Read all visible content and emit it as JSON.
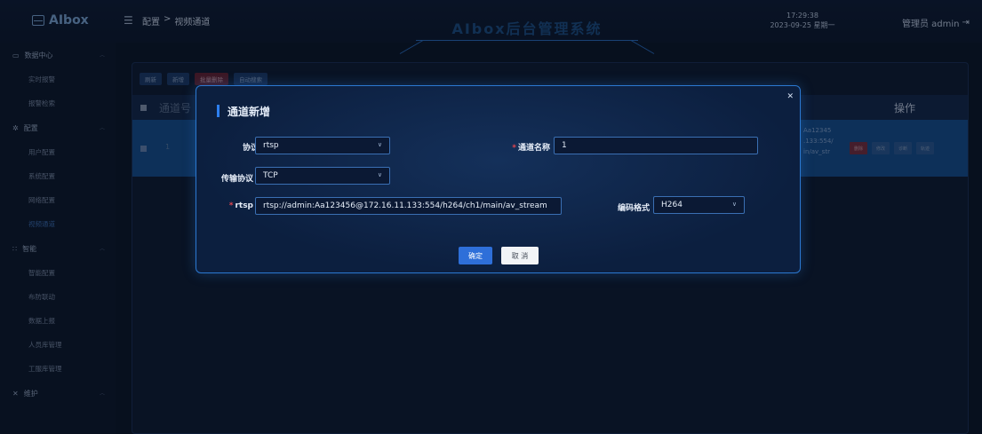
{
  "header": {
    "logo": "AIbox",
    "breadcrumb": [
      "配置",
      ">",
      "视频通道"
    ],
    "title": "AIbox后台管理系统",
    "time": "17:29:38",
    "date": "2023-09-25 星期一",
    "user": "管理员 admin"
  },
  "sidebar": {
    "groups": [
      {
        "label": "数据中心",
        "items": [
          "实时报警",
          "报警检索"
        ]
      },
      {
        "label": "配置",
        "items": [
          "用户配置",
          "系统配置",
          "网络配置",
          "视频通道"
        ]
      },
      {
        "label": "智能",
        "items": [
          "智能配置",
          "布防联动",
          "数据上报",
          "人员库管理",
          "工服库管理"
        ]
      },
      {
        "label": "维护",
        "items": []
      }
    ]
  },
  "toolbar": {
    "refresh": "刷新",
    "add": "新增",
    "batch_delete": "批量删除",
    "auto_search": "自动搜索"
  },
  "table": {
    "col_channel": "通道号",
    "col_ops": "操作",
    "row": {
      "num": "1",
      "rtsp_fragment": "Aa12345\n.133:554/\nin/av_str",
      "ops": [
        "删除",
        "修改",
        "诊断",
        "轨迹"
      ]
    }
  },
  "modal": {
    "title": "通道新增",
    "protocol_label": "协议",
    "protocol_value": "rtsp",
    "channel_name_label": "通道名称",
    "channel_name_value": "1",
    "transport_label": "传输协议",
    "transport_value": "TCP",
    "rtsp_label": "rtsp",
    "rtsp_value": "rtsp://admin:Aa123456@172.16.11.133:554/h264/ch1/main/av_stream",
    "codec_label": "编码格式",
    "codec_value": "H264",
    "ok": "确定",
    "cancel": "取 消"
  },
  "colors": {
    "accent": "#2e6fd9",
    "danger": "#7a2e3e",
    "required": "#e2464f"
  }
}
